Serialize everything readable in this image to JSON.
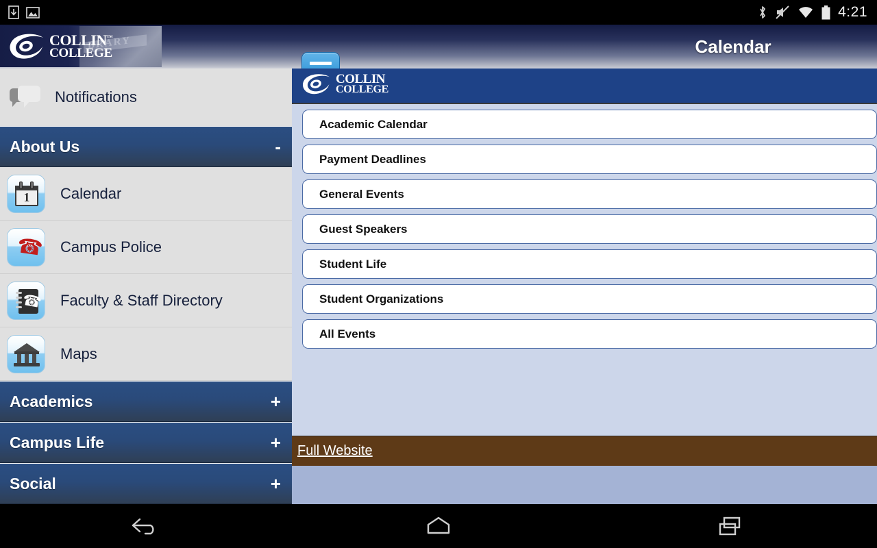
{
  "statusbar": {
    "left_icons": [
      "download-icon",
      "image-icon"
    ],
    "right_icons": [
      "bluetooth-icon",
      "mute-icon",
      "wifi-icon",
      "battery-icon"
    ],
    "clock": "4:21"
  },
  "header": {
    "brand_line1": "COLLIN",
    "brand_tm": "™",
    "brand_line2": "COLLEGE",
    "banner_photo_word": "BRARY",
    "menu_button_label": "menu",
    "title": "Calendar"
  },
  "sidebar": {
    "notifications": {
      "label": "Notifications",
      "icon": "speech-bubble-icon"
    },
    "sections": [
      {
        "title": "About Us",
        "sign": "-",
        "expanded": true,
        "items": [
          {
            "label": "Calendar",
            "icon": "calendar-icon",
            "day": "1"
          },
          {
            "label": "Campus Police",
            "icon": "phone-icon"
          },
          {
            "label": "Faculty & Staff Directory",
            "icon": "address-book-icon"
          },
          {
            "label": "Maps",
            "icon": "bank-building-icon"
          }
        ]
      },
      {
        "title": "Academics",
        "sign": "+",
        "expanded": false,
        "items": []
      },
      {
        "title": "Campus Life",
        "sign": "+",
        "expanded": false,
        "items": []
      },
      {
        "title": "Social",
        "sign": "+",
        "expanded": false,
        "items": []
      }
    ]
  },
  "content": {
    "brand_line1": "COLLIN",
    "brand_line2": "COLLEGE",
    "list": [
      {
        "label": "Academic Calendar"
      },
      {
        "label": "Payment Deadlines"
      },
      {
        "label": "General Events"
      },
      {
        "label": "Guest Speakers"
      },
      {
        "label": "Student Life"
      },
      {
        "label": "Student Organizations"
      },
      {
        "label": "All Events"
      }
    ],
    "full_website_label": "Full Website"
  },
  "navbar": {
    "buttons": [
      {
        "name": "back-button",
        "icon": "back-arrow-icon"
      },
      {
        "name": "home-button",
        "icon": "home-icon"
      },
      {
        "name": "recents-button",
        "icon": "recents-icon"
      }
    ]
  },
  "colors": {
    "brand_blue": "#1e4287",
    "header_dark": "#141b43",
    "accent_button": "#3c9ddc",
    "content_bg": "#ccd6ea",
    "full_website_bar": "#5e3a17",
    "page_fill": "#a4b3d5"
  }
}
